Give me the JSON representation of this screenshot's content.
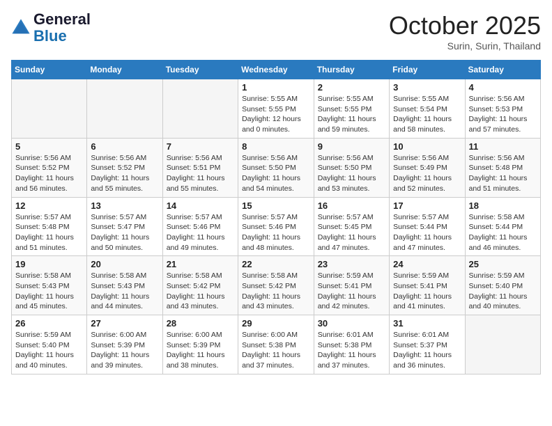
{
  "header": {
    "logo_line1": "General",
    "logo_line2": "Blue",
    "month": "October 2025",
    "location": "Surin, Surin, Thailand"
  },
  "weekdays": [
    "Sunday",
    "Monday",
    "Tuesday",
    "Wednesday",
    "Thursday",
    "Friday",
    "Saturday"
  ],
  "weeks": [
    [
      {
        "day": "",
        "info": ""
      },
      {
        "day": "",
        "info": ""
      },
      {
        "day": "",
        "info": ""
      },
      {
        "day": "1",
        "info": "Sunrise: 5:55 AM\nSunset: 5:55 PM\nDaylight: 12 hours\nand 0 minutes."
      },
      {
        "day": "2",
        "info": "Sunrise: 5:55 AM\nSunset: 5:55 PM\nDaylight: 11 hours\nand 59 minutes."
      },
      {
        "day": "3",
        "info": "Sunrise: 5:55 AM\nSunset: 5:54 PM\nDaylight: 11 hours\nand 58 minutes."
      },
      {
        "day": "4",
        "info": "Sunrise: 5:56 AM\nSunset: 5:53 PM\nDaylight: 11 hours\nand 57 minutes."
      }
    ],
    [
      {
        "day": "5",
        "info": "Sunrise: 5:56 AM\nSunset: 5:52 PM\nDaylight: 11 hours\nand 56 minutes."
      },
      {
        "day": "6",
        "info": "Sunrise: 5:56 AM\nSunset: 5:52 PM\nDaylight: 11 hours\nand 55 minutes."
      },
      {
        "day": "7",
        "info": "Sunrise: 5:56 AM\nSunset: 5:51 PM\nDaylight: 11 hours\nand 55 minutes."
      },
      {
        "day": "8",
        "info": "Sunrise: 5:56 AM\nSunset: 5:50 PM\nDaylight: 11 hours\nand 54 minutes."
      },
      {
        "day": "9",
        "info": "Sunrise: 5:56 AM\nSunset: 5:50 PM\nDaylight: 11 hours\nand 53 minutes."
      },
      {
        "day": "10",
        "info": "Sunrise: 5:56 AM\nSunset: 5:49 PM\nDaylight: 11 hours\nand 52 minutes."
      },
      {
        "day": "11",
        "info": "Sunrise: 5:56 AM\nSunset: 5:48 PM\nDaylight: 11 hours\nand 51 minutes."
      }
    ],
    [
      {
        "day": "12",
        "info": "Sunrise: 5:57 AM\nSunset: 5:48 PM\nDaylight: 11 hours\nand 51 minutes."
      },
      {
        "day": "13",
        "info": "Sunrise: 5:57 AM\nSunset: 5:47 PM\nDaylight: 11 hours\nand 50 minutes."
      },
      {
        "day": "14",
        "info": "Sunrise: 5:57 AM\nSunset: 5:46 PM\nDaylight: 11 hours\nand 49 minutes."
      },
      {
        "day": "15",
        "info": "Sunrise: 5:57 AM\nSunset: 5:46 PM\nDaylight: 11 hours\nand 48 minutes."
      },
      {
        "day": "16",
        "info": "Sunrise: 5:57 AM\nSunset: 5:45 PM\nDaylight: 11 hours\nand 47 minutes."
      },
      {
        "day": "17",
        "info": "Sunrise: 5:57 AM\nSunset: 5:44 PM\nDaylight: 11 hours\nand 47 minutes."
      },
      {
        "day": "18",
        "info": "Sunrise: 5:58 AM\nSunset: 5:44 PM\nDaylight: 11 hours\nand 46 minutes."
      }
    ],
    [
      {
        "day": "19",
        "info": "Sunrise: 5:58 AM\nSunset: 5:43 PM\nDaylight: 11 hours\nand 45 minutes."
      },
      {
        "day": "20",
        "info": "Sunrise: 5:58 AM\nSunset: 5:43 PM\nDaylight: 11 hours\nand 44 minutes."
      },
      {
        "day": "21",
        "info": "Sunrise: 5:58 AM\nSunset: 5:42 PM\nDaylight: 11 hours\nand 43 minutes."
      },
      {
        "day": "22",
        "info": "Sunrise: 5:58 AM\nSunset: 5:42 PM\nDaylight: 11 hours\nand 43 minutes."
      },
      {
        "day": "23",
        "info": "Sunrise: 5:59 AM\nSunset: 5:41 PM\nDaylight: 11 hours\nand 42 minutes."
      },
      {
        "day": "24",
        "info": "Sunrise: 5:59 AM\nSunset: 5:41 PM\nDaylight: 11 hours\nand 41 minutes."
      },
      {
        "day": "25",
        "info": "Sunrise: 5:59 AM\nSunset: 5:40 PM\nDaylight: 11 hours\nand 40 minutes."
      }
    ],
    [
      {
        "day": "26",
        "info": "Sunrise: 5:59 AM\nSunset: 5:40 PM\nDaylight: 11 hours\nand 40 minutes."
      },
      {
        "day": "27",
        "info": "Sunrise: 6:00 AM\nSunset: 5:39 PM\nDaylight: 11 hours\nand 39 minutes."
      },
      {
        "day": "28",
        "info": "Sunrise: 6:00 AM\nSunset: 5:39 PM\nDaylight: 11 hours\nand 38 minutes."
      },
      {
        "day": "29",
        "info": "Sunrise: 6:00 AM\nSunset: 5:38 PM\nDaylight: 11 hours\nand 37 minutes."
      },
      {
        "day": "30",
        "info": "Sunrise: 6:01 AM\nSunset: 5:38 PM\nDaylight: 11 hours\nand 37 minutes."
      },
      {
        "day": "31",
        "info": "Sunrise: 6:01 AM\nSunset: 5:37 PM\nDaylight: 11 hours\nand 36 minutes."
      },
      {
        "day": "",
        "info": ""
      }
    ]
  ]
}
